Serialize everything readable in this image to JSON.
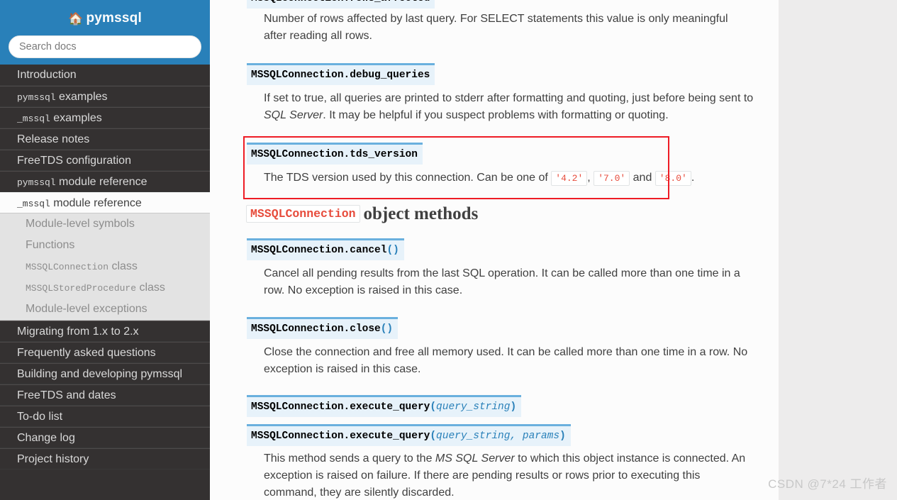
{
  "sidebar": {
    "brand": "pymssql",
    "home_icon": "home-icon",
    "search": {
      "placeholder": "Search docs",
      "value": ""
    },
    "items": [
      {
        "label": "Introduction",
        "mono": "",
        "current": false
      },
      {
        "label": " examples",
        "mono": "pymssql",
        "current": false
      },
      {
        "label": " examples",
        "mono": "_mssql",
        "current": false
      },
      {
        "label": "Release notes",
        "mono": "",
        "current": false
      },
      {
        "label": "FreeTDS configuration",
        "mono": "",
        "current": false
      },
      {
        "label": " module reference",
        "mono": "pymssql",
        "current": false
      },
      {
        "label": " module reference",
        "mono": "_mssql",
        "current": true
      },
      {
        "label": "Migrating from 1.x to 2.x",
        "mono": "",
        "current": false
      },
      {
        "label": "Frequently asked questions",
        "mono": "",
        "current": false
      },
      {
        "label": "Building and developing pymssql",
        "mono": "",
        "current": false
      },
      {
        "label": "FreeTDS and dates",
        "mono": "",
        "current": false
      },
      {
        "label": "To-do list",
        "mono": "",
        "current": false
      },
      {
        "label": "Change log",
        "mono": "",
        "current": false
      },
      {
        "label": "Project history",
        "mono": "",
        "current": false
      }
    ],
    "subitems": [
      {
        "label": "Module-level symbols",
        "mono": ""
      },
      {
        "label": "Functions",
        "mono": ""
      },
      {
        "label": " class",
        "mono": "MSSQLConnection"
      },
      {
        "label": " class",
        "mono": "MSSQLStoredProcedure"
      },
      {
        "label": "Module-level exceptions",
        "mono": ""
      }
    ]
  },
  "content": {
    "rows_affected": {
      "signature": "MSSQLConnection.rows_affected",
      "description": "Number of rows affected by last query. For SELECT statements this value is only meaningful after reading all rows."
    },
    "debug_queries": {
      "signature": "MSSQLConnection.debug_queries",
      "desc_part1": "If set to true, all queries are printed to stderr after formatting and quoting, just before being sent to ",
      "desc_em": "SQL Server",
      "desc_part2": ". It may be helpful if you suspect problems with formatting or quoting."
    },
    "tds_version": {
      "signature": "MSSQLConnection.tds_version",
      "desc_part1": "The TDS version used by this connection. Can be one of ",
      "lit1": "'4.2'",
      "sep1": ", ",
      "lit2": "'7.0'",
      "sep2": " and ",
      "lit3": "'8.0'",
      "desc_part2": "."
    },
    "methods_heading": {
      "code": "MSSQLConnection",
      "text": "object methods"
    },
    "cancel": {
      "sig_name": "MSSQLConnection.cancel",
      "sig_paren": "()",
      "description": "Cancel all pending results from the last SQL operation. It can be called more than one time in a row. No exception is raised in this case."
    },
    "close": {
      "sig_name": "MSSQLConnection.close",
      "sig_paren": "()",
      "description": "Close the connection and free all memory used. It can be called more than one time in a row. No exception is raised in this case."
    },
    "execute_query": {
      "sig_name_1": "MSSQLConnection.execute_query",
      "sig_open_1": "(",
      "sig_param_1": "query_string",
      "sig_close_1": ")",
      "sig_name_2": "MSSQLConnection.execute_query",
      "sig_open_2": "(",
      "sig_param_2": "query_string, params",
      "sig_close_2": ")",
      "desc_part1": "This method sends a query to the ",
      "desc_em": "MS SQL Server",
      "desc_part2": " to which this object instance is connected. An exception is raised on failure. If there are pending results or rows prior to executing this command, they are silently discarded."
    }
  },
  "annotation": {
    "color": "#ee1c25"
  },
  "watermark": {
    "text": "CSDN @7*24 工作者"
  }
}
